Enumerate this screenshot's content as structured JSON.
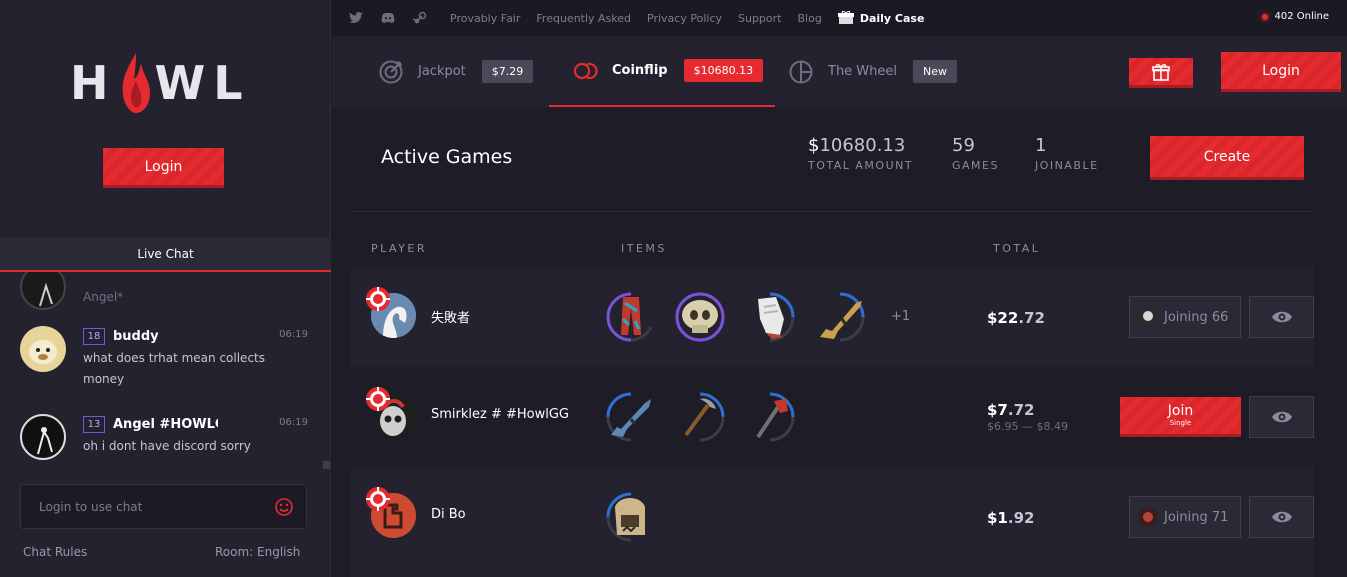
{
  "brand": {
    "logo_left": "H",
    "logo_right": "WL"
  },
  "sidebar": {
    "login_label": "Login",
    "chat_title": "Live Chat",
    "partial_user": "Angel*",
    "messages": [
      {
        "level": "18",
        "user": "buddy",
        "time": "06:19",
        "text": "what does trhat mean collects money"
      },
      {
        "level": "13",
        "user": "Angel #HOWLGG",
        "time": "06:19",
        "text": "oh i dont have discord sorry"
      }
    ],
    "chat_placeholder": "Login to use chat",
    "chat_rules": "Chat Rules",
    "room": "Room: English"
  },
  "topbar": {
    "links": [
      "Provably Fair",
      "Frequently Asked",
      "Privacy Policy",
      "Support",
      "Blog"
    ],
    "daily_case": "Daily Case",
    "online": "402 Online"
  },
  "modes": [
    {
      "label": "Jackpot",
      "badge": "$7.29",
      "icon": "target-icon"
    },
    {
      "label": "Coinflip",
      "badge": "$10680.13",
      "icon": "coinflip-icon"
    },
    {
      "label": "The Wheel",
      "badge": "New",
      "icon": "wheel-icon"
    }
  ],
  "header": {
    "login_label": "Login",
    "gift_icon": "gift-icon"
  },
  "main": {
    "title": "Active Games",
    "total_amount_dollar": "$",
    "total_amount": "10680.13",
    "total_amount_label": "TOTAL AMOUNT",
    "games": "59",
    "games_label": "GAMES",
    "joinable": "1",
    "joinable_label": "JOINABLE",
    "create_label": "Create",
    "columns": {
      "player": "PLAYER",
      "items": "ITEMS",
      "total": "TOTAL"
    }
  },
  "games": [
    {
      "player": "失敗者",
      "more": "+1",
      "total_int": "$22",
      "total_dec": ".72",
      "status": "Joining 66"
    },
    {
      "player": "Smirklez # #HowlGG",
      "total_int": "$7",
      "total_dec": ".72",
      "range": "$6.95 — $8.49",
      "join_label": "Join",
      "join_sub": "Single"
    },
    {
      "player": "Di Bo",
      "total_int": "$1",
      "total_dec": ".92",
      "status": "Joining 71"
    }
  ],
  "colors": {
    "accent": "#e52b30",
    "background": "#1d1c27",
    "panel": "#23222e",
    "level_border": "#7a53d8"
  }
}
